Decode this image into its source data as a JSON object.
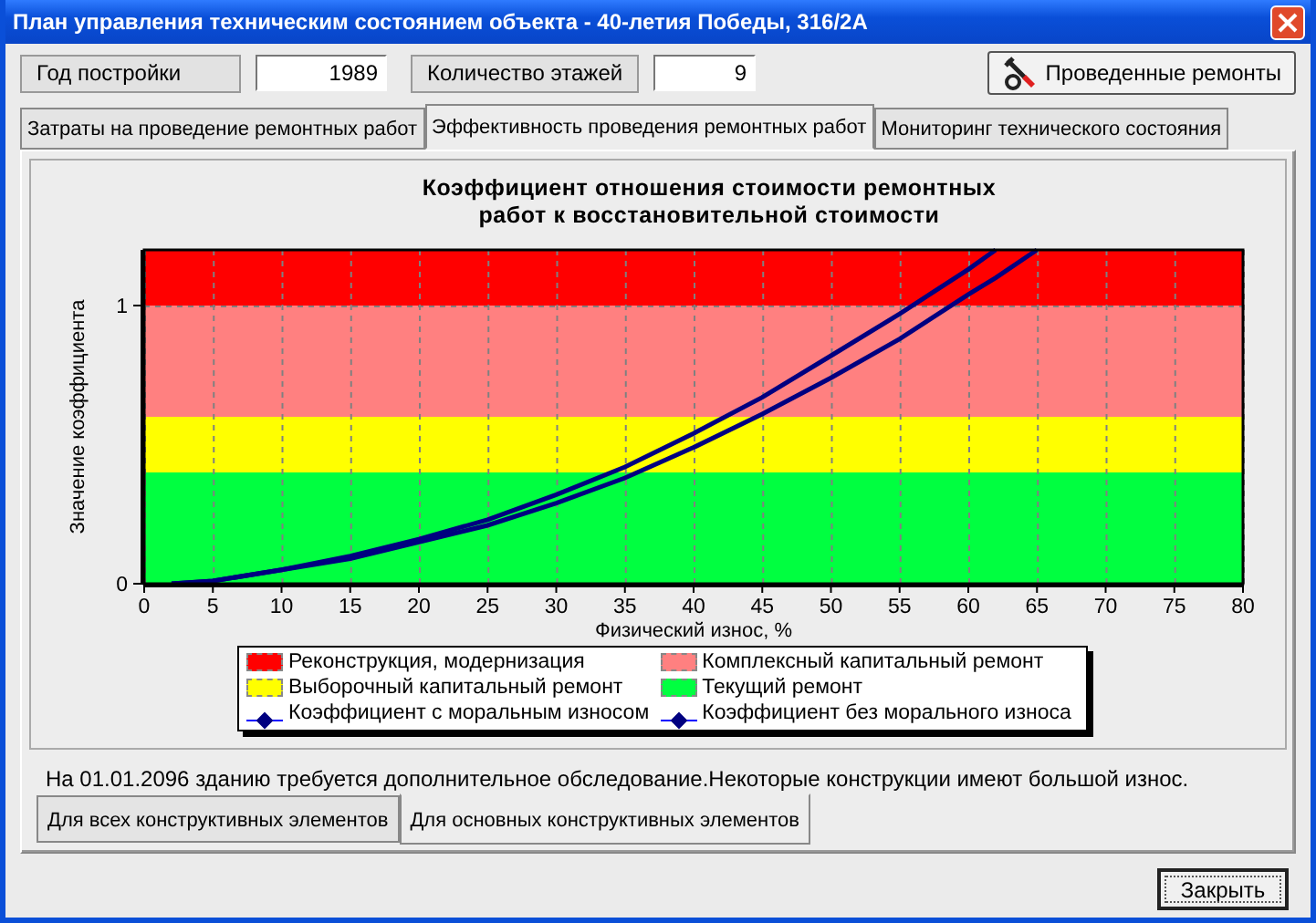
{
  "window": {
    "title": "План управления техническим состоянием объекта - 40-летия Победы, 316/2А"
  },
  "fields": [
    {
      "label": "Год постройки",
      "value": "1989"
    },
    {
      "label": "Количество этажей",
      "value": "9"
    }
  ],
  "repairs_button": {
    "label": "Проведенные ремонты"
  },
  "tabs": [
    {
      "label": "Затраты на проведение ремонтных работ",
      "selected": false
    },
    {
      "label": "Эффективность проведения ремонтных работ",
      "selected": true
    },
    {
      "label": "Мониторинг технического состояния",
      "selected": false
    }
  ],
  "chart_data": {
    "type": "line",
    "title": "Коэффициент отношения стоимости ремонтных работ к восстановительной стоимости",
    "xlabel": "Физический износ, %",
    "ylabel": "Значение коэффициента",
    "x": [
      2,
      5,
      10,
      15,
      20,
      25,
      30,
      35,
      40,
      45,
      50,
      55,
      60,
      62,
      65
    ],
    "series": [
      {
        "name": "Коэффициент с моральным износом",
        "color": "#000080",
        "values": [
          0,
          0.01,
          0.05,
          0.1,
          0.16,
          0.23,
          0.32,
          0.42,
          0.54,
          0.67,
          0.82,
          0.97,
          1.13,
          1.2,
          null
        ]
      },
      {
        "name": "Коэффициент без морального износа",
        "color": "#000080",
        "values": [
          0,
          0.01,
          0.05,
          0.09,
          0.15,
          0.21,
          0.29,
          0.38,
          0.49,
          0.61,
          0.74,
          0.88,
          1.04,
          1.1,
          1.2
        ]
      }
    ],
    "xlim": [
      0,
      80
    ],
    "ylim": [
      0,
      1.2
    ],
    "xticks": [
      0,
      5,
      10,
      15,
      20,
      25,
      30,
      35,
      40,
      45,
      50,
      55,
      60,
      65,
      70,
      75,
      80
    ],
    "yticks": [
      0,
      1
    ],
    "grid": true,
    "bands": [
      {
        "axis": "y",
        "from": 1,
        "to": 1.2,
        "color": "#ff0000",
        "label": "Реконструкция, модернизация"
      },
      {
        "axis": "y",
        "from": 0.6,
        "to": 1,
        "color": "#ff8080",
        "label": "Комплексный капитальный ремонт"
      },
      {
        "axis": "y",
        "from": 0.4,
        "to": 0.6,
        "color": "#ffff00",
        "label": "Выборочный капитальный ремонт"
      },
      {
        "axis": "y",
        "from": 0,
        "to": 0.4,
        "color": "#00ff40",
        "label": "Текущий ремонт"
      }
    ]
  },
  "status_message": "На 01.01.2096 зданию требуется дополнительное обследование.Некоторые конструкции имеют большой износ.",
  "bottom_tabs": [
    {
      "label": "Для всех конструктивных элементов",
      "selected": false
    },
    {
      "label": "Для основных конструктивных элементов",
      "selected": true
    }
  ],
  "close_button": {
    "label": "Закрыть"
  }
}
